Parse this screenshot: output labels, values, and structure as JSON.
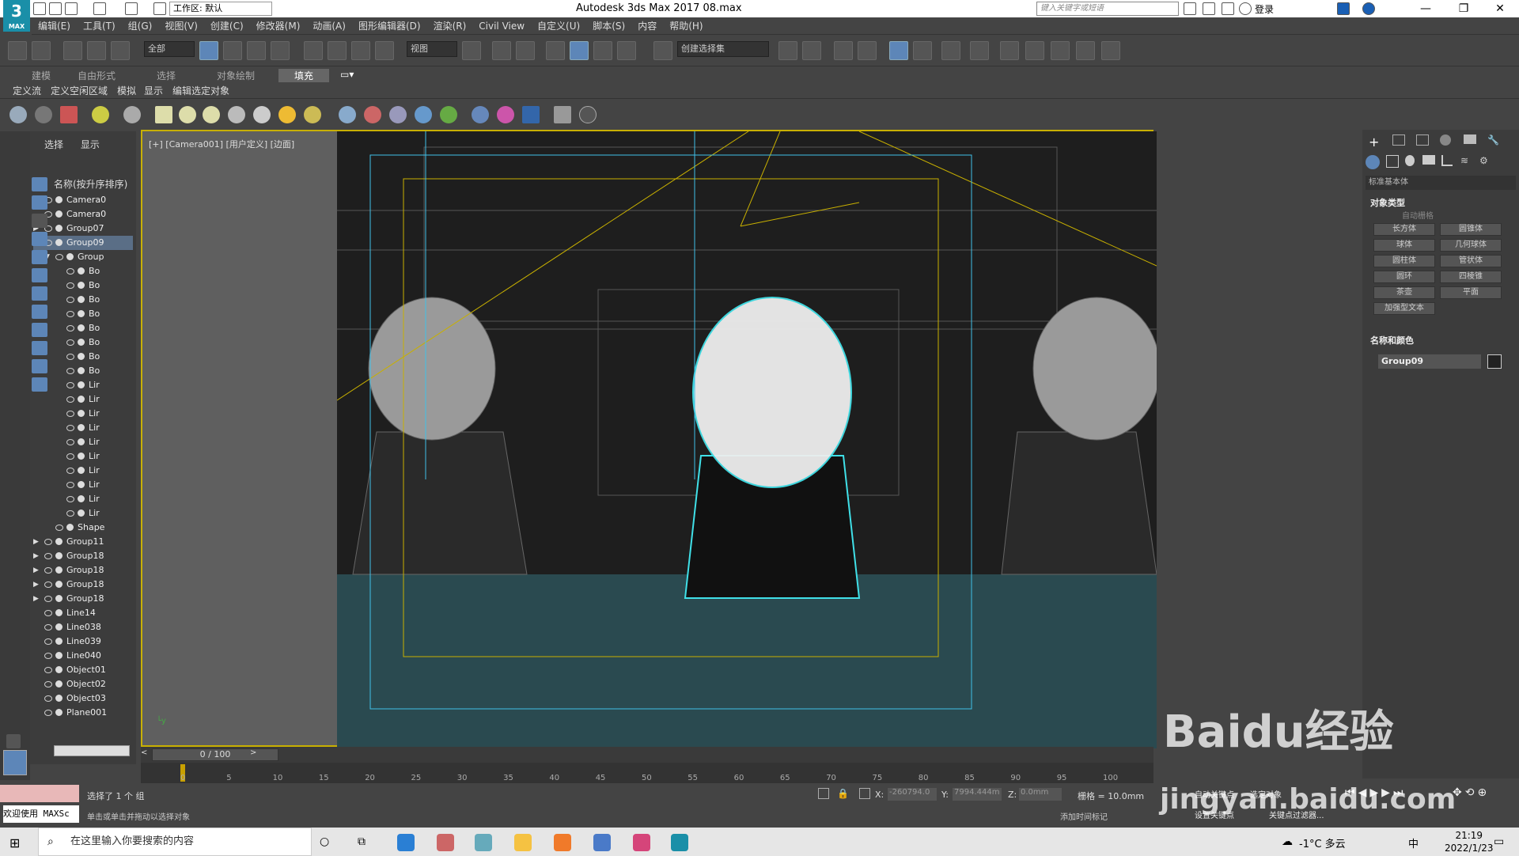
{
  "titlebar": {
    "logo": "3",
    "logo_sub": "MAX",
    "workspace": "工作区: 默认",
    "title": "Autodesk 3ds Max 2017      08.max",
    "search_placeholder": "键入关键字或短语",
    "login": "登录"
  },
  "menu": [
    "编辑(E)",
    "工具(T)",
    "组(G)",
    "视图(V)",
    "创建(C)",
    "修改器(M)",
    "动画(A)",
    "图形编辑器(D)",
    "渲染(R)",
    "Civil View",
    "自定义(U)",
    "脚本(S)",
    "内容",
    "帮助(H)"
  ],
  "toolbar": {
    "filter": "全部",
    "view": "视图",
    "selection_set": "创建选择集"
  },
  "ribbon": {
    "tabs": [
      "建模",
      "自由形式",
      "选择",
      "对象绘制",
      "填充"
    ],
    "active_tab": "填充",
    "subtabs": [
      "定义流",
      "定义空闲区域",
      "模拟",
      "显示",
      "编辑选定对象"
    ]
  },
  "scene_explorer": {
    "tabs": [
      "选择",
      "显示"
    ],
    "header": "名称(按升序排序)",
    "rows": [
      {
        "name": "Camera0",
        "indent": 0,
        "arrow": "",
        "sel": false
      },
      {
        "name": "Camera0",
        "indent": 0,
        "arrow": "",
        "sel": false
      },
      {
        "name": "Group07",
        "indent": 0,
        "arrow": "▶",
        "sel": false
      },
      {
        "name": "Group09",
        "indent": 0,
        "arrow": "▼",
        "sel": true
      },
      {
        "name": "Group",
        "indent": 1,
        "arrow": "▼",
        "sel": false
      },
      {
        "name": "Bo",
        "indent": 2,
        "arrow": "",
        "sel": false
      },
      {
        "name": "Bo",
        "indent": 2,
        "arrow": "",
        "sel": false
      },
      {
        "name": "Bo",
        "indent": 2,
        "arrow": "",
        "sel": false
      },
      {
        "name": "Bo",
        "indent": 2,
        "arrow": "",
        "sel": false
      },
      {
        "name": "Bo",
        "indent": 2,
        "arrow": "",
        "sel": false
      },
      {
        "name": "Bo",
        "indent": 2,
        "arrow": "",
        "sel": false
      },
      {
        "name": "Bo",
        "indent": 2,
        "arrow": "",
        "sel": false
      },
      {
        "name": "Bo",
        "indent": 2,
        "arrow": "",
        "sel": false
      },
      {
        "name": "Lir",
        "indent": 2,
        "arrow": "",
        "sel": false
      },
      {
        "name": "Lir",
        "indent": 2,
        "arrow": "",
        "sel": false
      },
      {
        "name": "Lir",
        "indent": 2,
        "arrow": "",
        "sel": false
      },
      {
        "name": "Lir",
        "indent": 2,
        "arrow": "",
        "sel": false
      },
      {
        "name": "Lir",
        "indent": 2,
        "arrow": "",
        "sel": false
      },
      {
        "name": "Lir",
        "indent": 2,
        "arrow": "",
        "sel": false
      },
      {
        "name": "Lir",
        "indent": 2,
        "arrow": "",
        "sel": false
      },
      {
        "name": "Lir",
        "indent": 2,
        "arrow": "",
        "sel": false
      },
      {
        "name": "Lir",
        "indent": 2,
        "arrow": "",
        "sel": false
      },
      {
        "name": "Lir",
        "indent": 2,
        "arrow": "",
        "sel": false
      },
      {
        "name": "Shape",
        "indent": 1,
        "arrow": "",
        "sel": false
      },
      {
        "name": "Group11",
        "indent": 0,
        "arrow": "▶",
        "sel": false
      },
      {
        "name": "Group18",
        "indent": 0,
        "arrow": "▶",
        "sel": false
      },
      {
        "name": "Group18",
        "indent": 0,
        "arrow": "▶",
        "sel": false
      },
      {
        "name": "Group18",
        "indent": 0,
        "arrow": "▶",
        "sel": false
      },
      {
        "name": "Group18",
        "indent": 0,
        "arrow": "▶",
        "sel": false
      },
      {
        "name": "Line14",
        "indent": 0,
        "arrow": "",
        "sel": false
      },
      {
        "name": "Line038",
        "indent": 0,
        "arrow": "",
        "sel": false
      },
      {
        "name": "Line039",
        "indent": 0,
        "arrow": "",
        "sel": false
      },
      {
        "name": "Line040",
        "indent": 0,
        "arrow": "",
        "sel": false
      },
      {
        "name": "Object01",
        "indent": 0,
        "arrow": "",
        "sel": false
      },
      {
        "name": "Object02",
        "indent": 0,
        "arrow": "",
        "sel": false
      },
      {
        "name": "Object03",
        "indent": 0,
        "arrow": "",
        "sel": false
      },
      {
        "name": "Plane001",
        "indent": 0,
        "arrow": "",
        "sel": false
      }
    ]
  },
  "viewport": {
    "label": "[+] [Camera001] [用户定义] [边面]",
    "frame_color": "#c8b000",
    "selection_color": "#40e0e8",
    "floor_color": "#2a4a50"
  },
  "command_panel": {
    "dropdown": "标准基本体",
    "section_object_type": "对象类型",
    "autogrid": "自动栅格",
    "buttons": [
      "长方体",
      "圆锥体",
      "球体",
      "几何球体",
      "圆柱体",
      "管状体",
      "圆环",
      "四棱锥",
      "茶壶",
      "平面",
      "加强型文本"
    ],
    "section_name_color": "名称和颜色",
    "object_name": "Group09"
  },
  "timeline": {
    "slider": "0 / 100",
    "ticks": [
      "0",
      "5",
      "10",
      "15",
      "20",
      "25",
      "30",
      "35",
      "40",
      "45",
      "50",
      "55",
      "60",
      "65",
      "70",
      "75",
      "80",
      "85",
      "90",
      "95",
      "100"
    ]
  },
  "status": {
    "welcome": "欢迎使用 MAXSc",
    "selected": "选择了 1 个 组",
    "hint": "单击或单击并拖动以选择对象",
    "x_label": "X:",
    "x_value": "-260794.0",
    "y_label": "Y:",
    "y_value": "7994.444m",
    "z_label": "Z:",
    "z_value": "0.0mm",
    "grid": "栅格 = 10.0mm",
    "add_time_tag": "添加时间标记",
    "auto_key": "自动关键点",
    "selected_obj": "选定对象",
    "set_key": "设置关键点",
    "key_filters": "关键点过滤器..."
  },
  "taskbar": {
    "search": "在这里输入你要搜索的内容",
    "weather": "-1°C 多云",
    "ime": "中",
    "time": "21:19",
    "date": "2022/1/23"
  },
  "watermark": {
    "text": "Baidu经验",
    "url": "jingyan.baidu.com"
  }
}
